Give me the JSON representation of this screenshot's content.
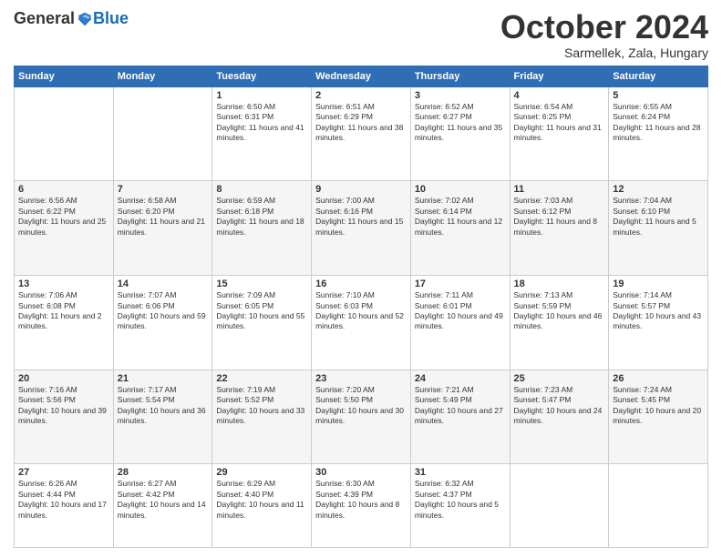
{
  "header": {
    "logo_general": "General",
    "logo_blue": "Blue",
    "month_title": "October 2024",
    "subtitle": "Sarmellek, Zala, Hungary"
  },
  "weekdays": [
    "Sunday",
    "Monday",
    "Tuesday",
    "Wednesday",
    "Thursday",
    "Friday",
    "Saturday"
  ],
  "weeks": [
    [
      {
        "day": "",
        "text": "",
        "empty": true
      },
      {
        "day": "",
        "text": "",
        "empty": true
      },
      {
        "day": "1",
        "text": "Sunrise: 6:50 AM\nSunset: 6:31 PM\nDaylight: 11 hours and 41 minutes."
      },
      {
        "day": "2",
        "text": "Sunrise: 6:51 AM\nSunset: 6:29 PM\nDaylight: 11 hours and 38 minutes."
      },
      {
        "day": "3",
        "text": "Sunrise: 6:52 AM\nSunset: 6:27 PM\nDaylight: 11 hours and 35 minutes."
      },
      {
        "day": "4",
        "text": "Sunrise: 6:54 AM\nSunset: 6:25 PM\nDaylight: 11 hours and 31 minutes."
      },
      {
        "day": "5",
        "text": "Sunrise: 6:55 AM\nSunset: 6:24 PM\nDaylight: 11 hours and 28 minutes."
      }
    ],
    [
      {
        "day": "6",
        "text": "Sunrise: 6:56 AM\nSunset: 6:22 PM\nDaylight: 11 hours and 25 minutes."
      },
      {
        "day": "7",
        "text": "Sunrise: 6:58 AM\nSunset: 6:20 PM\nDaylight: 11 hours and 21 minutes."
      },
      {
        "day": "8",
        "text": "Sunrise: 6:59 AM\nSunset: 6:18 PM\nDaylight: 11 hours and 18 minutes."
      },
      {
        "day": "9",
        "text": "Sunrise: 7:00 AM\nSunset: 6:16 PM\nDaylight: 11 hours and 15 minutes."
      },
      {
        "day": "10",
        "text": "Sunrise: 7:02 AM\nSunset: 6:14 PM\nDaylight: 11 hours and 12 minutes."
      },
      {
        "day": "11",
        "text": "Sunrise: 7:03 AM\nSunset: 6:12 PM\nDaylight: 11 hours and 8 minutes."
      },
      {
        "day": "12",
        "text": "Sunrise: 7:04 AM\nSunset: 6:10 PM\nDaylight: 11 hours and 5 minutes."
      }
    ],
    [
      {
        "day": "13",
        "text": "Sunrise: 7:06 AM\nSunset: 6:08 PM\nDaylight: 11 hours and 2 minutes."
      },
      {
        "day": "14",
        "text": "Sunrise: 7:07 AM\nSunset: 6:06 PM\nDaylight: 10 hours and 59 minutes."
      },
      {
        "day": "15",
        "text": "Sunrise: 7:09 AM\nSunset: 6:05 PM\nDaylight: 10 hours and 55 minutes."
      },
      {
        "day": "16",
        "text": "Sunrise: 7:10 AM\nSunset: 6:03 PM\nDaylight: 10 hours and 52 minutes."
      },
      {
        "day": "17",
        "text": "Sunrise: 7:11 AM\nSunset: 6:01 PM\nDaylight: 10 hours and 49 minutes."
      },
      {
        "day": "18",
        "text": "Sunrise: 7:13 AM\nSunset: 5:59 PM\nDaylight: 10 hours and 46 minutes."
      },
      {
        "day": "19",
        "text": "Sunrise: 7:14 AM\nSunset: 5:57 PM\nDaylight: 10 hours and 43 minutes."
      }
    ],
    [
      {
        "day": "20",
        "text": "Sunrise: 7:16 AM\nSunset: 5:56 PM\nDaylight: 10 hours and 39 minutes."
      },
      {
        "day": "21",
        "text": "Sunrise: 7:17 AM\nSunset: 5:54 PM\nDaylight: 10 hours and 36 minutes."
      },
      {
        "day": "22",
        "text": "Sunrise: 7:19 AM\nSunset: 5:52 PM\nDaylight: 10 hours and 33 minutes."
      },
      {
        "day": "23",
        "text": "Sunrise: 7:20 AM\nSunset: 5:50 PM\nDaylight: 10 hours and 30 minutes."
      },
      {
        "day": "24",
        "text": "Sunrise: 7:21 AM\nSunset: 5:49 PM\nDaylight: 10 hours and 27 minutes."
      },
      {
        "day": "25",
        "text": "Sunrise: 7:23 AM\nSunset: 5:47 PM\nDaylight: 10 hours and 24 minutes."
      },
      {
        "day": "26",
        "text": "Sunrise: 7:24 AM\nSunset: 5:45 PM\nDaylight: 10 hours and 20 minutes."
      }
    ],
    [
      {
        "day": "27",
        "text": "Sunrise: 6:26 AM\nSunset: 4:44 PM\nDaylight: 10 hours and 17 minutes."
      },
      {
        "day": "28",
        "text": "Sunrise: 6:27 AM\nSunset: 4:42 PM\nDaylight: 10 hours and 14 minutes."
      },
      {
        "day": "29",
        "text": "Sunrise: 6:29 AM\nSunset: 4:40 PM\nDaylight: 10 hours and 11 minutes."
      },
      {
        "day": "30",
        "text": "Sunrise: 6:30 AM\nSunset: 4:39 PM\nDaylight: 10 hours and 8 minutes."
      },
      {
        "day": "31",
        "text": "Sunrise: 6:32 AM\nSunset: 4:37 PM\nDaylight: 10 hours and 5 minutes."
      },
      {
        "day": "",
        "text": "",
        "empty": true
      },
      {
        "day": "",
        "text": "",
        "empty": true
      }
    ]
  ]
}
